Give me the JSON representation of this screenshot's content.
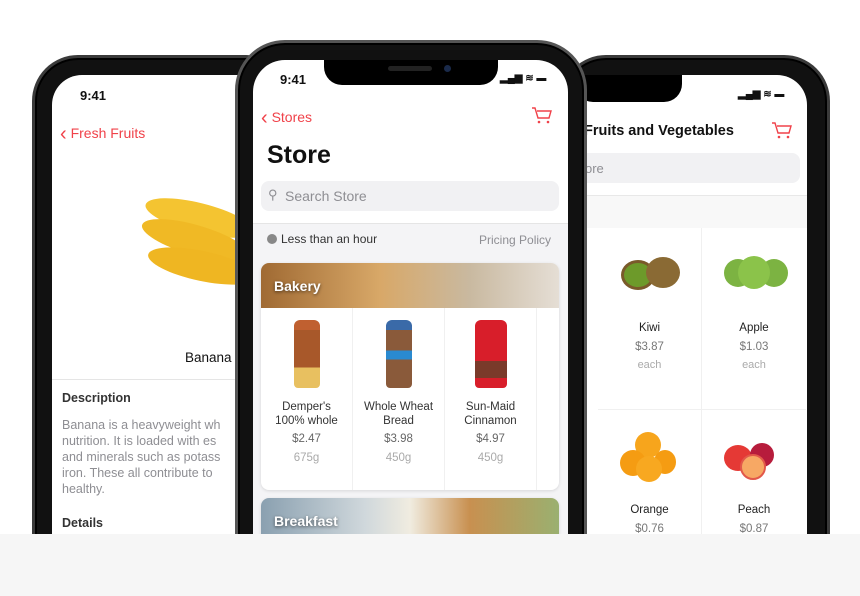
{
  "accent": "#f0424a",
  "left_phone": {
    "time": "9:41",
    "back_label": "Fresh Fruits",
    "product_name": "Banana",
    "description_heading": "Description",
    "description_lines": [
      "Banana is a heavyweight wh",
      "nutrition. It is loaded with es",
      "and minerals such as potass",
      "iron. These all contribute to",
      "healthy."
    ],
    "details_heading": "Details"
  },
  "middle_phone": {
    "time": "9:41",
    "back_label": "Stores",
    "title": "Store",
    "search_placeholder": "Search Store",
    "delivery_time": "Less than an hour",
    "pricing_policy": "Pricing Policy",
    "categories": [
      {
        "title": "Bakery",
        "products": [
          {
            "name_line1": "Demper's",
            "name_line2": "100% whole",
            "price": "$2.47",
            "weight": "675g"
          },
          {
            "name_line1": "Whole Wheat",
            "name_line2": "Bread",
            "price": "$3.98",
            "weight": "450g"
          },
          {
            "name_line1": "Sun-Maid",
            "name_line2": "Cinnamon",
            "price": "$4.97",
            "weight": "450g"
          }
        ]
      },
      {
        "title": "Breakfast"
      }
    ]
  },
  "right_phone": {
    "title": "Fruits and Vegetables",
    "search_partial": "ore",
    "items": [
      {
        "name": "Kiwi",
        "price": "$3.87",
        "unit": "each"
      },
      {
        "name": "Apple",
        "price": "$1.03",
        "unit": "each"
      },
      {
        "name": "Orange",
        "price": "$0.76"
      },
      {
        "name": "Peach",
        "price": "$0.87"
      }
    ]
  }
}
